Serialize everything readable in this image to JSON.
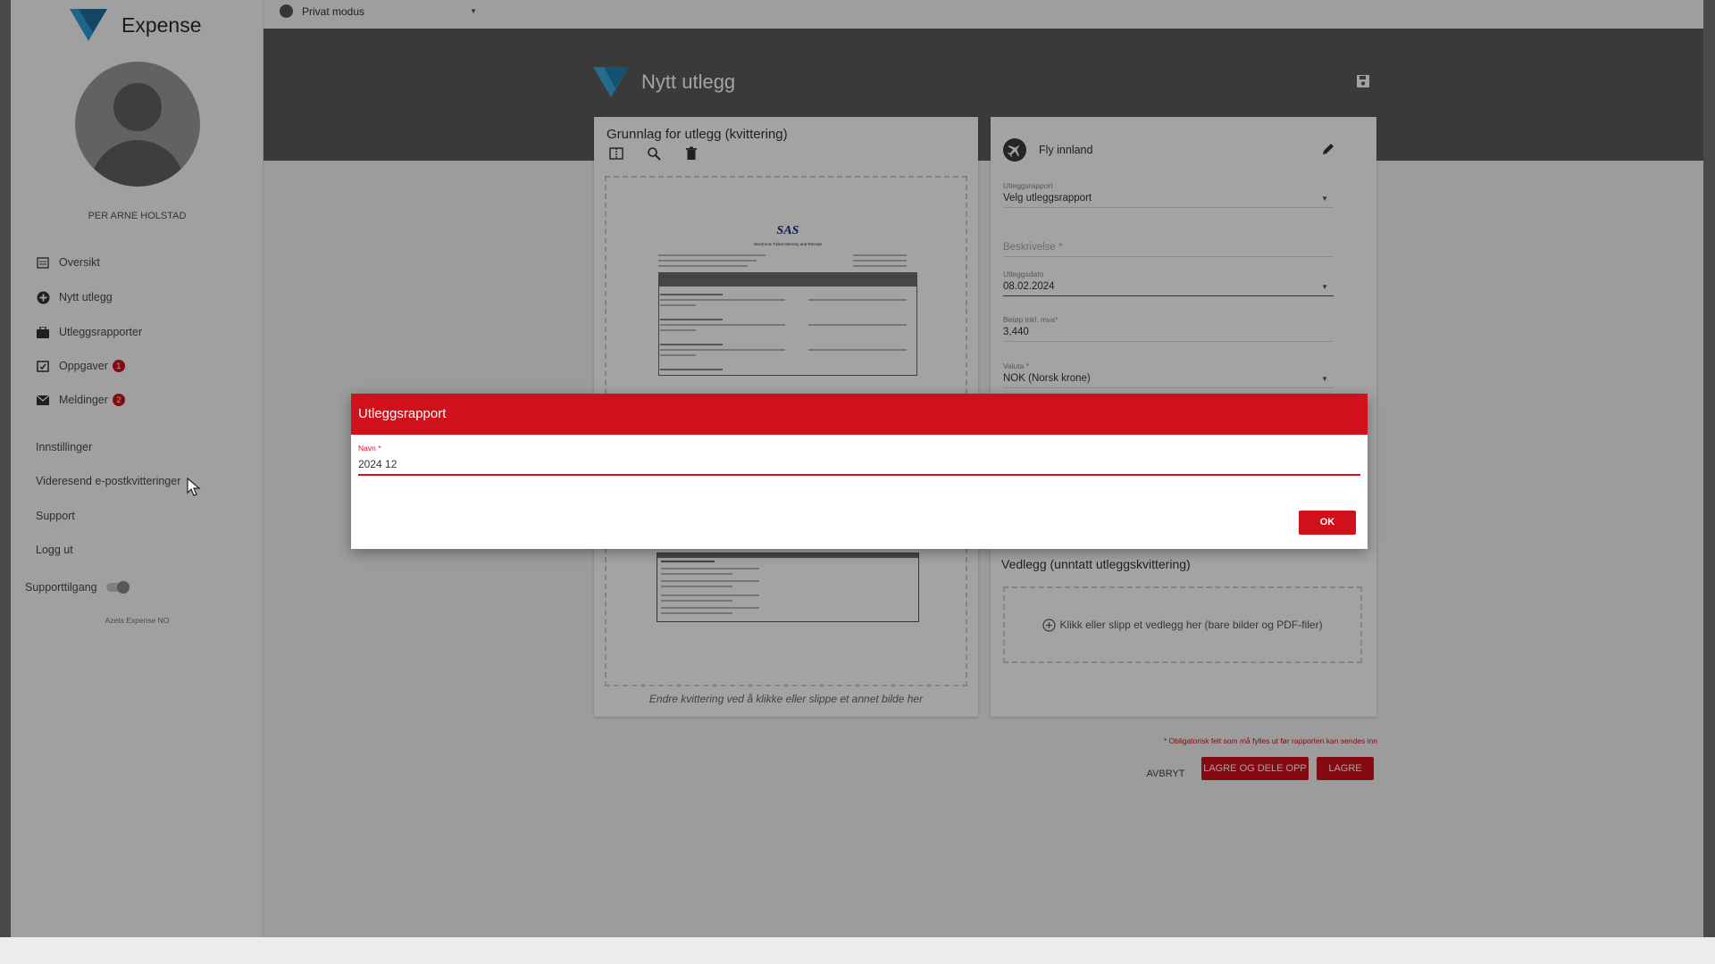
{
  "app": {
    "name": "Expense"
  },
  "colors": {
    "accent": "#d0111b",
    "brand": "#2b9fd6",
    "header": "#5b5b5b"
  },
  "sidebar": {
    "username": "PER ARNE HOLSTAD",
    "nav": [
      {
        "label": "Oversikt",
        "icon": "calendar-list-icon"
      },
      {
        "label": "Nytt utlegg",
        "icon": "plus-circle-icon"
      },
      {
        "label": "Utleggsrapporter",
        "icon": "briefcase-icon"
      },
      {
        "label": "Oppgaver",
        "icon": "checklist-icon",
        "badge": "1"
      },
      {
        "label": "Meldinger",
        "icon": "envelope-icon",
        "badge": "2"
      }
    ],
    "links": [
      "Innstillinger",
      "Videresend e-postkvitteringer",
      "Support",
      "Logg ut"
    ],
    "support_toggle": "Supporttilgang",
    "footer": "Azets Expense NO"
  },
  "topbar": {
    "mode": "Privat modus"
  },
  "header": {
    "title": "Nytt utlegg"
  },
  "receipt_card": {
    "title": "Grunnlag for utlegg (kvittering)",
    "change_hint": "Endre kvittering ved å klikke eller slippe et annet bilde her",
    "airline": "SAS",
    "doc_title": "Electronic Ticket Itinerary and Receipt"
  },
  "details_card": {
    "category": "Fly innland",
    "fields": {
      "report": {
        "label": "Utleggsrapport",
        "value": "Velg utleggsrapport"
      },
      "description": {
        "label": "Beskrivelse *",
        "value": ""
      },
      "date": {
        "label": "Utleggsdato",
        "value": "08.02.2024"
      },
      "amount": {
        "label": "Beløp inkl. mva*",
        "value": "3,440"
      },
      "currency": {
        "label": "Valuta *",
        "value": "NOK (Norsk krone)"
      }
    },
    "attachments_title": "Vedlegg (unntatt utleggskvittering)",
    "attachments_hint": "Klikk eller slipp et vedlegg her (bare bilder og PDF-filer)"
  },
  "actions": {
    "required_note": "* Obligatorisk felt som må fylles ut før rapporten kan sendes inn",
    "cancel": "AVBRYT",
    "save_split": "LAGRE OG DELE OPP",
    "save": "LAGRE"
  },
  "dialog": {
    "title": "Utleggsrapport",
    "name_label": "Navn *",
    "name_value": "2024 12",
    "ok": "OK"
  }
}
